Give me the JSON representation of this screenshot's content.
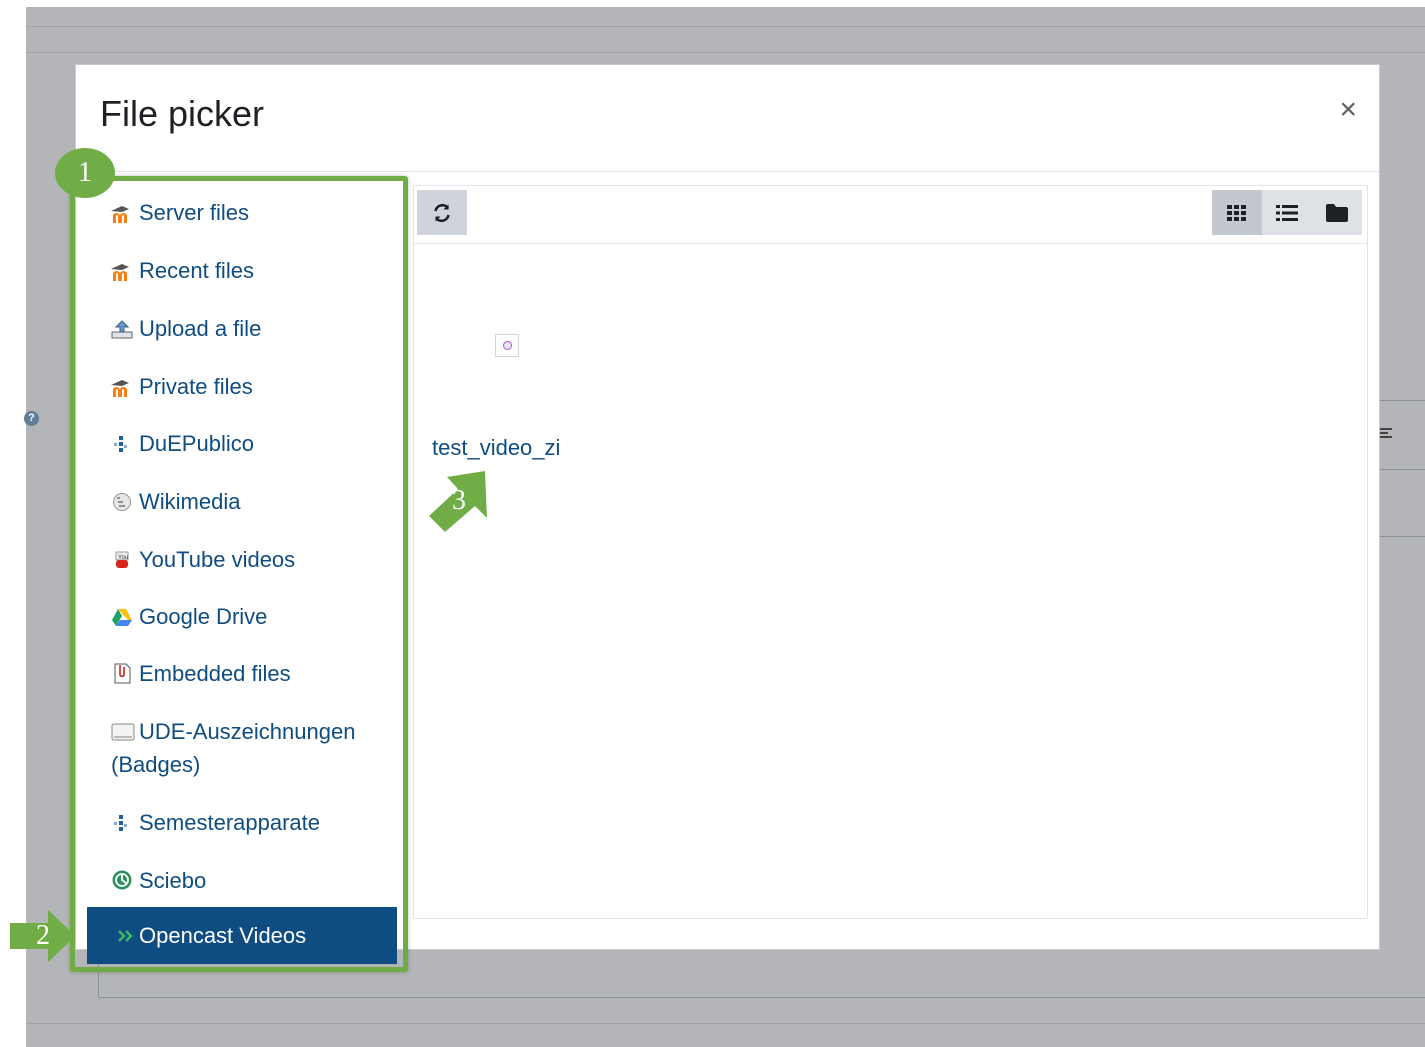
{
  "modal": {
    "title": "File picker",
    "close_symbol": "×"
  },
  "repositories": [
    {
      "label": "Server files",
      "icon": "moodle-icon"
    },
    {
      "label": "Recent files",
      "icon": "moodle-icon"
    },
    {
      "label": "Upload a file",
      "icon": "upload-icon"
    },
    {
      "label": "Private files",
      "icon": "moodle-icon"
    },
    {
      "label": "DuEPublico",
      "icon": "duepublico-icon"
    },
    {
      "label": "Wikimedia",
      "icon": "wikimedia-icon"
    },
    {
      "label": "YouTube videos",
      "icon": "youtube-icon"
    },
    {
      "label": "Google Drive",
      "icon": "google-drive-icon"
    },
    {
      "label": "Embedded files",
      "icon": "embedded-files-icon"
    },
    {
      "label": "UDE-Auszeichnungen (Badges)",
      "icon": "badges-icon"
    },
    {
      "label": "Semesterapparate",
      "icon": "semesterapparate-icon"
    },
    {
      "label": "Sciebo",
      "icon": "sciebo-icon"
    },
    {
      "label": "Opencast Videos",
      "icon": "opencast-icon",
      "active": true
    }
  ],
  "toolbar": {
    "refresh_icon": "refresh-icon",
    "views": [
      "icon-view",
      "list-view",
      "tree-view"
    ]
  },
  "files": [
    {
      "name": "test_video_zi",
      "icon": "video-file-icon"
    }
  ],
  "annotations": {
    "badge_1": "1",
    "badge_2": "2",
    "badge_3": "3",
    "accent_color": "#70ad47"
  },
  "colors": {
    "link": "#0f4c81",
    "active_bg": "#0f4c81",
    "backdrop": "#b3b5b8"
  }
}
